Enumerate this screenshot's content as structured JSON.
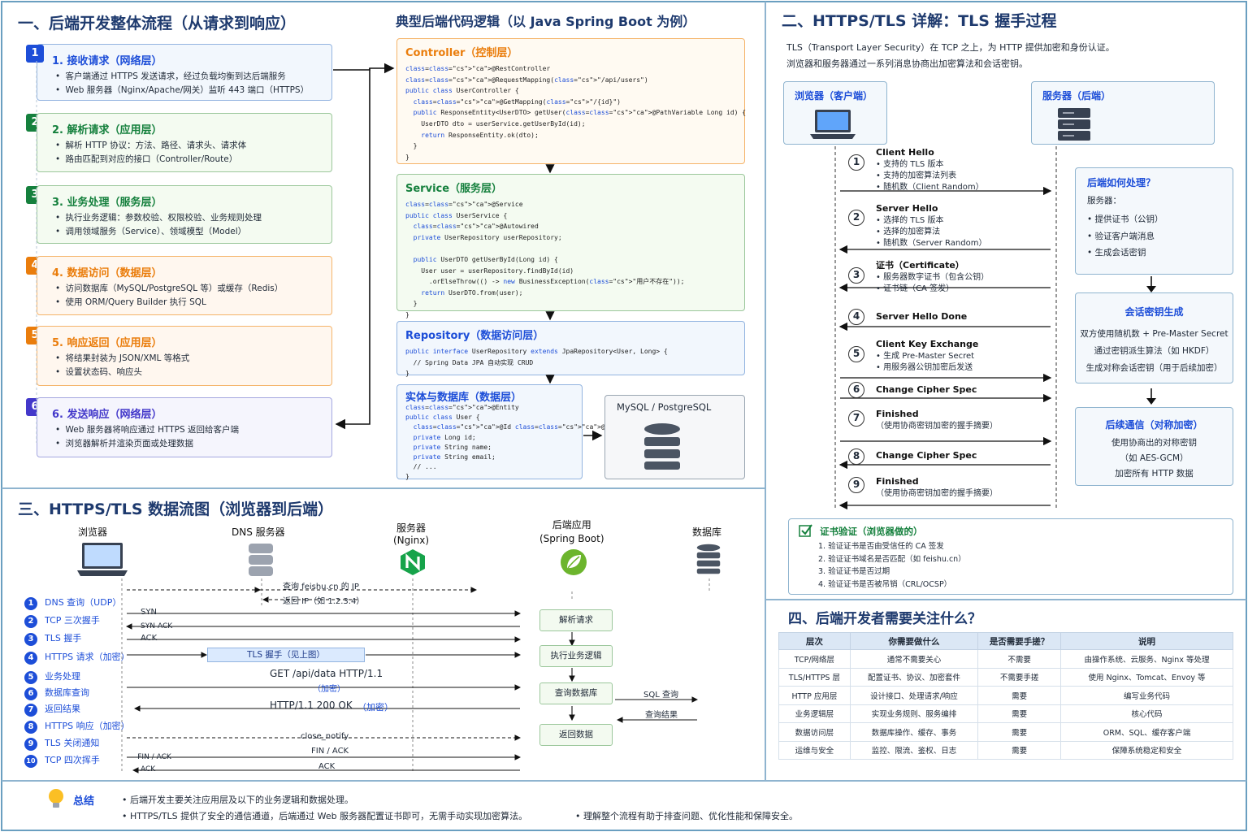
{
  "section1": {
    "title": "一、后端开发整体流程（从请求到响应）",
    "steps": [
      {
        "num": "1",
        "title": "1. 接收请求（网络层）",
        "lines": [
          "客户端通过 HTTPS 发送请求，经过负载均衡到达后端服务",
          "Web 服务器（Nginx/Apache/网关）监听 443 端口（HTTPS）"
        ]
      },
      {
        "num": "2",
        "title": "2. 解析请求（应用层）",
        "lines": [
          "解析 HTTP 协议：方法、路径、请求头、请求体",
          "路由匹配到对应的接口（Controller/Route）"
        ]
      },
      {
        "num": "3",
        "title": "3. 业务处理（服务层）",
        "lines": [
          "执行业务逻辑：参数校验、权限校验、业务规则处理",
          "调用领域服务（Service）、领域模型（Model）"
        ]
      },
      {
        "num": "4",
        "title": "4. 数据访问（数据层）",
        "lines": [
          "访问数据库（MySQL/PostgreSQL 等）或缓存（Redis）",
          "使用 ORM/Query Builder 执行 SQL"
        ]
      },
      {
        "num": "5",
        "title": "5. 响应返回（应用层）",
        "lines": [
          "将结果封装为 JSON/XML 等格式",
          "设置状态码、响应头"
        ]
      },
      {
        "num": "6",
        "title": "6. 发送响应（网络层）",
        "lines": [
          "Web 服务器将响应通过 HTTPS 返回给客户端",
          "浏览器解析并渲染页面或处理数据"
        ]
      }
    ]
  },
  "code": {
    "title": "典型后端代码逻辑（以 Java Spring Boot 为例）",
    "controller": {
      "title": "Controller（控制层）",
      "lines": [
        "@RestController",
        "@RequestMapping(\"/api/users\")",
        "public class UserController {",
        "  @GetMapping(\"/{id}\")",
        "  public ResponseEntity<UserDTO> getUser(@PathVariable Long id) {",
        "    UserDTO dto = userService.getUserById(id);",
        "    return ResponseEntity.ok(dto);",
        "  }",
        "}"
      ]
    },
    "service": {
      "title": "Service（服务层）",
      "lines": [
        "@Service",
        "public class UserService {",
        "  @Autowired",
        "  private UserRepository userRepository;",
        "",
        "  public UserDTO getUserById(Long id) {",
        "    User user = userRepository.findById(id)",
        "      .orElseThrow(() -> new BusinessException(\"用户不存在\"));",
        "    return UserDTO.from(user);",
        "  }",
        "}"
      ]
    },
    "repository": {
      "title": "Repository（数据访问层）",
      "lines": [
        "public interface UserRepository extends JpaRepository<User, Long> {",
        "  // Spring Data JPA 自动实现 CRUD",
        "}"
      ]
    },
    "entity": {
      "title": "实体与数据库（数据层）",
      "lines": [
        "@Entity",
        "public class User {",
        "  @Id @GeneratedValue",
        "  private Long id;",
        "  private String name;",
        "  private String email;",
        "  // ...",
        "}"
      ]
    },
    "db_label": "MySQL / PostgreSQL"
  },
  "section2": {
    "title": "二、HTTPS/TLS 详解：TLS 握手过程",
    "intro": [
      "TLS（Transport Layer Security）在 TCP 之上，为 HTTP 提供加密和身份认证。",
      "浏览器和服务器通过一系列消息协商出加密算法和会话密钥。"
    ],
    "browser": "浏览器（客户端）",
    "server": "服务器（后端）",
    "messages": [
      {
        "n": "1",
        "title": "Client Hello",
        "lines": [
          "支持的 TLS 版本",
          "支持的加密算法列表",
          "随机数（Client Random）"
        ]
      },
      {
        "n": "2",
        "title": "Server Hello",
        "lines": [
          "选择的 TLS 版本",
          "选择的加密算法",
          "随机数（Server Random）"
        ]
      },
      {
        "n": "3",
        "title": "证书（Certificate）",
        "lines": [
          "服务器数字证书（包含公钥）",
          "证书链（CA 签发）"
        ]
      },
      {
        "n": "4",
        "title": "Server Hello Done",
        "lines": []
      },
      {
        "n": "5",
        "title": "Client Key Exchange",
        "lines": [
          "生成 Pre-Master Secret",
          "用服务器公钥加密后发送"
        ]
      },
      {
        "n": "6",
        "title": "Change Cipher Spec",
        "lines": []
      },
      {
        "n": "7",
        "title": "Finished",
        "lines": [
          "（使用协商密钥加密的握手摘要）"
        ]
      },
      {
        "n": "8",
        "title": "Change Cipher Spec",
        "lines": []
      },
      {
        "n": "9",
        "title": "Finished",
        "lines": [
          "（使用协商密钥加密的握手摘要）"
        ]
      }
    ],
    "box1": {
      "title": "后端如何处理？",
      "sub": "服务器：",
      "items": [
        "提供证书（公钥）",
        "验证客户端消息",
        "生成会话密钥"
      ]
    },
    "box2": {
      "title": "会话密钥生成",
      "lines": [
        "双方使用随机数 + Pre-Master Secret",
        "通过密钥派生算法（如 HKDF）",
        "生成对称会话密钥（用于后续加密）"
      ]
    },
    "box3": {
      "title": "后续通信（对称加密）",
      "lines": [
        "使用协商出的对称密钥",
        "（如 AES-GCM）",
        "加密所有 HTTP 数据"
      ]
    },
    "cert": {
      "title": "证书验证（浏览器做的）",
      "items": [
        "1.  验证证书是否由受信任的 CA 签发",
        "2.  验证证书域名是否匹配（如 feishu.cn）",
        "3.  验证证书是否过期",
        "4.  验证证书是否被吊销（CRL/OCSP）"
      ]
    }
  },
  "section3": {
    "title": "三、HTTPS/TLS 数据流图（浏览器到后端）",
    "cols": {
      "browser": "浏览器",
      "dns": "DNS 服务器",
      "nginx": [
        "服务器",
        "(Nginx)"
      ],
      "app": [
        "后端应用",
        "(Spring Boot)"
      ],
      "db": "数据库"
    },
    "steps": [
      {
        "n": "1",
        "t": "DNS 查询（UDP）"
      },
      {
        "n": "2",
        "t": "TCP 三次握手"
      },
      {
        "n": "3",
        "t": "TLS 握手"
      },
      {
        "n": "4",
        "t": "HTTPS 请求（加密）"
      },
      {
        "n": "5",
        "t": "业务处理"
      },
      {
        "n": "6",
        "t": "数据库查询"
      },
      {
        "n": "7",
        "t": "返回结果"
      },
      {
        "n": "8",
        "t": "HTTPS 响应（加密）"
      },
      {
        "n": "9",
        "t": "TLS 关闭通知"
      },
      {
        "n": "10",
        "t": "TCP 四次挥手"
      }
    ],
    "labels": {
      "dns_q": "查询 feishu.cn 的 IP",
      "dns_r": "返回 IP（如 1.2.3.4）",
      "syn": "SYN",
      "synack": "SYN-ACK",
      "ack": "ACK",
      "tls": "TLS 握手（见上图）",
      "req": "GET /api/data HTTP/1.1",
      "enc": "（加密）",
      "resp": "HTTP/1.1 200 OK",
      "resp_enc": "（加密）",
      "close": "close_notify",
      "finack": "FIN / ACK",
      "finack2": "-FIN / ACK",
      "ack2": "ACK",
      "ack3": "ACK",
      "sql": "SQL 查询",
      "result": "查询结果"
    },
    "appboxes": [
      "解析请求",
      "执行业务逻辑",
      "查询数据库",
      "返回数据"
    ]
  },
  "section4": {
    "title": "四、后端开发者需要关注什么？",
    "headers": [
      "层次",
      "你需要做什么",
      "是否需要手搓？",
      "说明"
    ],
    "rows": [
      [
        "TCP/网络层",
        "通常不需要关心",
        "不需要",
        "由操作系统、云服务、Nginx 等处理"
      ],
      [
        "TLS/HTTPS 层",
        "配置证书、协议、加密套件",
        "不需要手搓",
        "使用 Nginx、Tomcat、Envoy 等"
      ],
      [
        "HTTP 应用层",
        "设计接口、处理请求/响应",
        "需要",
        "编写业务代码"
      ],
      [
        "业务逻辑层",
        "实现业务规则、服务编排",
        "需要",
        "核心代码"
      ],
      [
        "数据访问层",
        "数据库操作、缓存、事务",
        "需要",
        "ORM、SQL、缓存客户端"
      ],
      [
        "运维与安全",
        "监控、限流、鉴权、日志",
        "需要",
        "保障系统稳定和安全"
      ]
    ]
  },
  "summary": {
    "title": "总结",
    "lines": [
      "•  后端开发主要关注应用层及以下的业务逻辑和数据处理。",
      "•  HTTPS/TLS 提供了安全的通信通道，后端通过 Web 服务器配置证书即可，无需手动实现加密算法。",
      "•  理解整个流程有助于排查问题、优化性能和保障安全。"
    ]
  },
  "colors": {
    "step1": "#1d4ed8",
    "step2": "#15803d",
    "step3": "#15803d",
    "step4": "#ea7d0c",
    "step5": "#ea7d0c",
    "step6": "#4338ca",
    "title": "#1e3a6e"
  }
}
